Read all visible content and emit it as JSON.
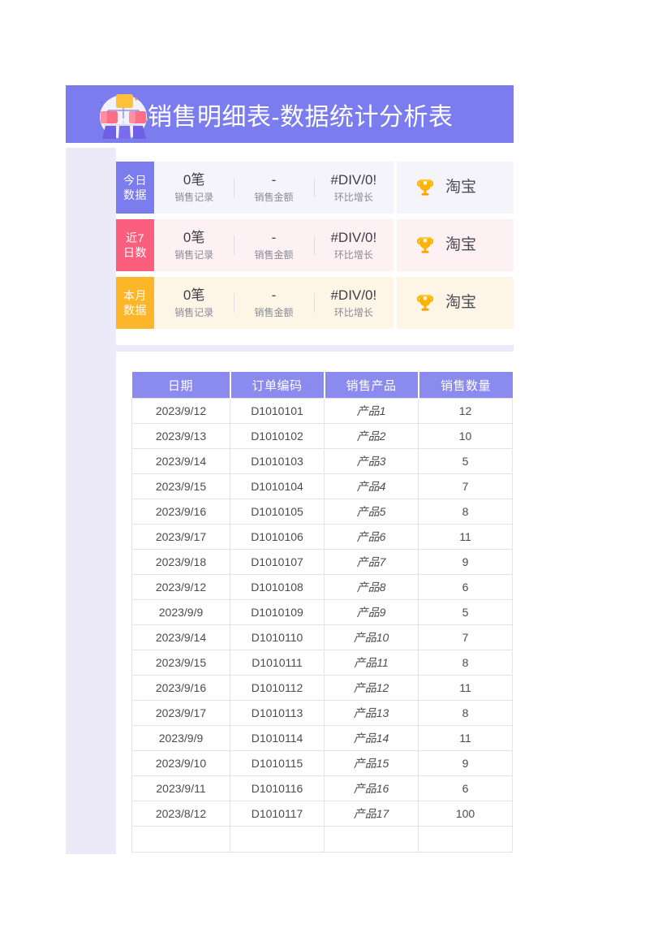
{
  "banner": {
    "title": "销售明细表-数据统计分析表",
    "icon": "org-chart-illustration",
    "bg_color": "#7b7ced"
  },
  "stat_cards": [
    {
      "badge": "今日\n数据",
      "badge_line1": "今日",
      "badge_line2": "数据",
      "badge_color": "#7b7ced",
      "bg_color": "#f5f4fb",
      "metrics": [
        {
          "value": "0笔",
          "label": "销售记录"
        },
        {
          "value": "-",
          "label": "销售金额"
        },
        {
          "value": "#DIV/0!",
          "label": "环比增长"
        }
      ],
      "aside": {
        "icon": "trophy-icon",
        "label": "淘宝"
      }
    },
    {
      "badge": "近7\n日数",
      "badge_line1": "近7",
      "badge_line2": "日数",
      "badge_color": "#fa5f7d",
      "bg_color": "#fdf1f4",
      "metrics": [
        {
          "value": "0笔",
          "label": "销售记录"
        },
        {
          "value": "-",
          "label": "销售金额"
        },
        {
          "value": "#DIV/0!",
          "label": "环比增长"
        }
      ],
      "aside": {
        "icon": "trophy-icon",
        "label": "淘宝"
      }
    },
    {
      "badge": "本月\n数据",
      "badge_line1": "本月",
      "badge_line2": "数据",
      "badge_color": "#fdb52a",
      "bg_color": "#fdf6e7",
      "metrics": [
        {
          "value": "0笔",
          "label": "销售记录"
        },
        {
          "value": "-",
          "label": "销售金额"
        },
        {
          "value": "#DIV/0!",
          "label": "环比增长"
        }
      ],
      "aside": {
        "icon": "trophy-icon",
        "label": "淘宝"
      }
    }
  ],
  "table": {
    "header_color": "#8b8aee",
    "columns": [
      "日期",
      "订单编码",
      "销售产品",
      "销售数量"
    ],
    "rows": [
      [
        "2023/9/12",
        "D1010101",
        "产品1",
        "12"
      ],
      [
        "2023/9/13",
        "D1010102",
        "产品2",
        "10"
      ],
      [
        "2023/9/14",
        "D1010103",
        "产品3",
        "5"
      ],
      [
        "2023/9/15",
        "D1010104",
        "产品4",
        "7"
      ],
      [
        "2023/9/16",
        "D1010105",
        "产品5",
        "8"
      ],
      [
        "2023/9/17",
        "D1010106",
        "产品6",
        "11"
      ],
      [
        "2023/9/18",
        "D1010107",
        "产品7",
        "9"
      ],
      [
        "2023/9/12",
        "D1010108",
        "产品8",
        "6"
      ],
      [
        "2023/9/9",
        "D1010109",
        "产品9",
        "5"
      ],
      [
        "2023/9/14",
        "D1010110",
        "产品10",
        "7"
      ],
      [
        "2023/9/15",
        "D1010111",
        "产品11",
        "8"
      ],
      [
        "2023/9/16",
        "D1010112",
        "产品12",
        "11"
      ],
      [
        "2023/9/17",
        "D1010113",
        "产品13",
        "8"
      ],
      [
        "2023/9/9",
        "D1010114",
        "产品14",
        "11"
      ],
      [
        "2023/9/10",
        "D1010115",
        "产品15",
        "9"
      ],
      [
        "2023/9/11",
        "D1010116",
        "产品16",
        "6"
      ],
      [
        "2023/8/12",
        "D1010117",
        "产品17",
        "100"
      ],
      [
        "",
        "",
        "",
        ""
      ]
    ]
  }
}
